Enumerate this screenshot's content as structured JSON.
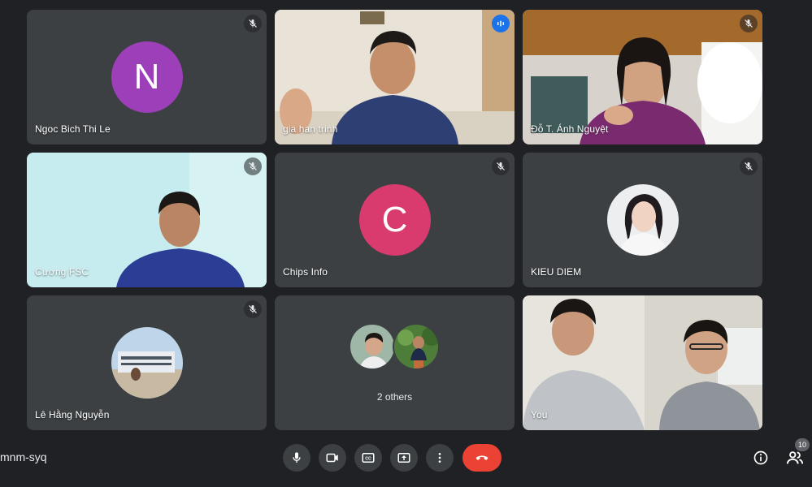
{
  "meeting": {
    "code": "mnm-syq"
  },
  "participants": [
    {
      "name": "Ngoc Bich Thi Le",
      "initial": "N",
      "color": "#9c3fb8",
      "muted": true
    },
    {
      "name": "gia han trinh",
      "speaking": true
    },
    {
      "name": "Đỗ T. Ánh Nguyệt",
      "muted": true
    },
    {
      "name": "Cương FSC",
      "muted": true
    },
    {
      "name": "Chips Info",
      "initial": "C",
      "color": "#d93b6e",
      "muted": true
    },
    {
      "name": "KIEU DIEM",
      "muted": true
    },
    {
      "name": "Lê Hằng Nguyễn",
      "muted": true
    },
    {
      "name": "2 others"
    },
    {
      "name": "You"
    }
  ],
  "people_count": "10",
  "icons": {
    "mute": "mic-off-icon",
    "speaking": "audio-level-icon",
    "mic": "mic-icon",
    "camera": "camera-icon",
    "captions": "captions-icon",
    "present": "present-screen-icon",
    "more": "more-options-icon",
    "hangup": "hang-up-icon",
    "info": "info-icon",
    "people": "people-icon"
  }
}
